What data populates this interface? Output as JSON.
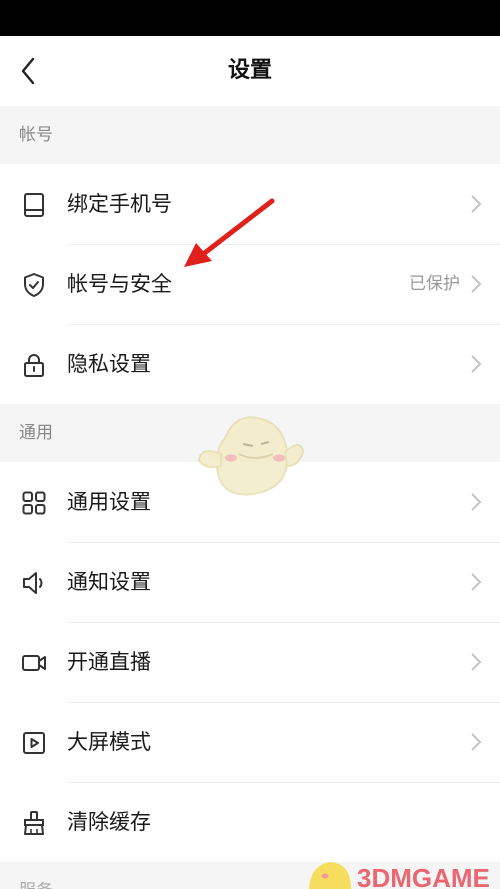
{
  "nav": {
    "title": "设置"
  },
  "sections": {
    "account": {
      "header": "帐号",
      "rows": [
        {
          "label": "绑定手机号",
          "value": "",
          "icon": "phone-icon"
        },
        {
          "label": "帐号与安全",
          "value": "已保护",
          "icon": "shield-check-icon"
        },
        {
          "label": "隐私设置",
          "value": "",
          "icon": "lock-icon"
        }
      ]
    },
    "general": {
      "header": "通用",
      "rows": [
        {
          "label": "通用设置",
          "value": "",
          "icon": "grid-icon"
        },
        {
          "label": "通知设置",
          "value": "",
          "icon": "speaker-icon"
        },
        {
          "label": "开通直播",
          "value": "",
          "icon": "video-camera-icon"
        },
        {
          "label": "大屏模式",
          "value": "",
          "icon": "play-square-icon"
        },
        {
          "label": "清除缓存",
          "value": "",
          "icon": "broom-icon"
        }
      ]
    },
    "service": {
      "header": "服务"
    }
  },
  "watermark": {
    "text": "3DMGAME"
  },
  "colors": {
    "background": "#f5f5f5",
    "row_background": "#ffffff",
    "annotation_arrow": "#e0211b",
    "secondary_text": "#999999"
  }
}
